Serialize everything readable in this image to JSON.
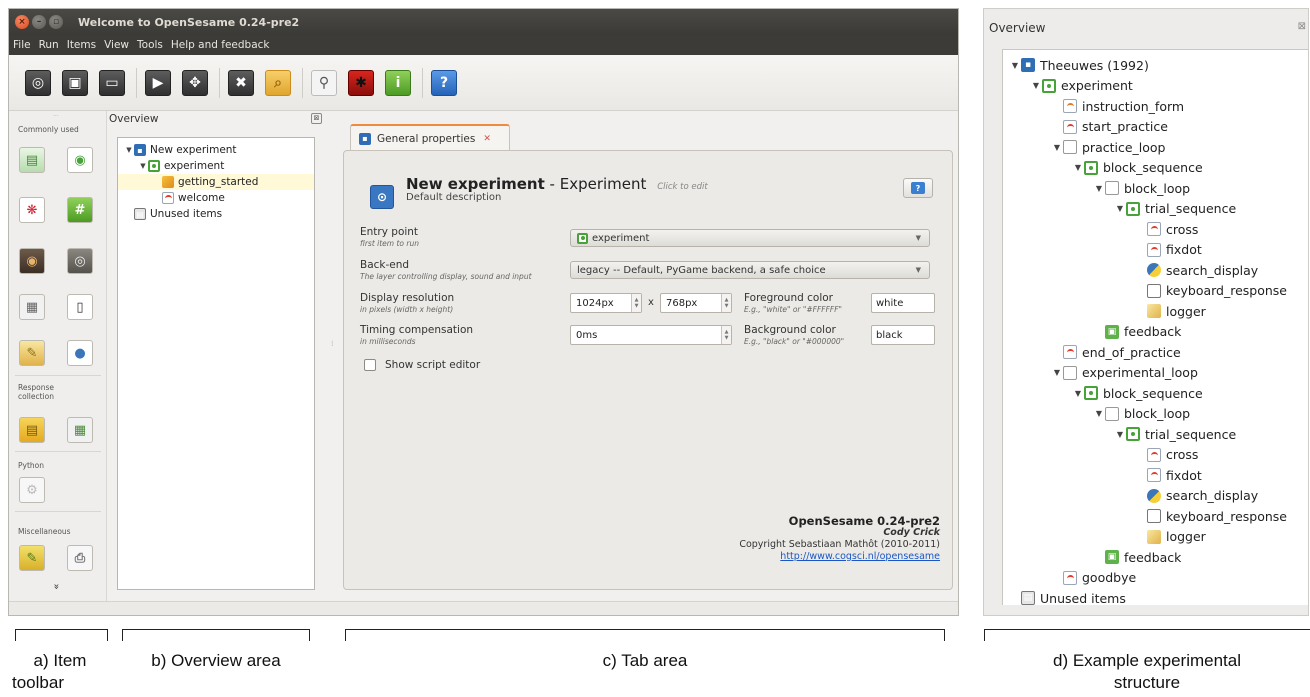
{
  "window": {
    "title": "Welcome to OpenSesame 0.24-pre2",
    "menu": [
      "File",
      "Run",
      "Items",
      "View",
      "Tools",
      "Help and feedback"
    ]
  },
  "toolbar_icons": [
    "new-icon",
    "open-icon",
    "save-icon",
    "run-icon",
    "run-window-icon",
    "kill-icon",
    "folder-icon",
    "search-icon",
    "bug-icon",
    "info-icon",
    "help-icon"
  ],
  "item_toolbar": {
    "categories": {
      "common": "Commonly used",
      "response": "Response collection",
      "python": "Python",
      "misc": "Miscellaneous"
    },
    "more_glyph": "»"
  },
  "overview": {
    "title": "Overview",
    "items": [
      {
        "label": "New experiment",
        "icon": "experiment-icon",
        "indent": 0,
        "arrow": "▼"
      },
      {
        "label": "experiment",
        "icon": "sequence-icon",
        "indent": 1,
        "arrow": "▼"
      },
      {
        "label": "getting_started",
        "icon": "inline-script-icon",
        "indent": 2,
        "arrow": ""
      },
      {
        "label": "welcome",
        "icon": "sketchpad-icon",
        "indent": 2,
        "arrow": ""
      },
      {
        "label": "Unused items",
        "icon": "trash-icon",
        "indent": 0,
        "arrow": ""
      }
    ]
  },
  "tab": {
    "label": "General properties",
    "experiment_name": "New experiment",
    "experiment_type": "- Experiment",
    "click_to_edit": "Click to edit",
    "description": "Default description",
    "entry_point_label": "Entry point",
    "entry_point_sub": "first item to run",
    "entry_point_value": "experiment",
    "backend_label": "Back-end",
    "backend_sub": "The layer controlling display, sound and input",
    "backend_value": "legacy -- Default, PyGame backend, a safe choice",
    "resolution_label": "Display resolution",
    "resolution_sub": "in pixels (width x height)",
    "width_value": "1024px",
    "x_sep": "x",
    "height_value": "768px",
    "fg_label": "Foreground color",
    "fg_sub": "E.g., \"white\" or \"#FFFFFF\"",
    "fg_value": "white",
    "timing_label": "Timing compensation",
    "timing_sub": "in milliseconds",
    "timing_value": "0ms",
    "bg_label": "Background color",
    "bg_sub": "E.g., \"black\" or \"#000000\"",
    "bg_value": "black",
    "script_editor_label": "Show script editor",
    "credits_version": "OpenSesame 0.24-pre2",
    "credits_codename": "Cody Crick",
    "credits_copyright": "Copyright Sebastiaan Mathôt (2010-2011)",
    "credits_url": "http://www.cogsci.nl/opensesame"
  },
  "example_structure": {
    "title": "Overview",
    "items": [
      {
        "label": "Theeuwes (1992)",
        "icon": "experiment-icon",
        "indent": 0,
        "arrow": "▼"
      },
      {
        "label": "experiment",
        "icon": "sequence-icon",
        "indent": 1,
        "arrow": "▼"
      },
      {
        "label": "instruction_form",
        "icon": "form-icon",
        "indent": 2,
        "arrow": ""
      },
      {
        "label": "start_practice",
        "icon": "sketchpad-icon",
        "indent": 2,
        "arrow": ""
      },
      {
        "label": "practice_loop",
        "icon": "loop-icon",
        "indent": 2,
        "arrow": "▼"
      },
      {
        "label": "block_sequence",
        "icon": "sequence-icon",
        "indent": 3,
        "arrow": "▼"
      },
      {
        "label": "block_loop",
        "icon": "loop-icon",
        "indent": 4,
        "arrow": "▼"
      },
      {
        "label": "trial_sequence",
        "icon": "sequence-icon",
        "indent": 5,
        "arrow": "▼"
      },
      {
        "label": "cross",
        "icon": "sketchpad-icon",
        "indent": 6,
        "arrow": ""
      },
      {
        "label": "fixdot",
        "icon": "sketchpad-icon",
        "indent": 6,
        "arrow": ""
      },
      {
        "label": "search_display",
        "icon": "python-icon",
        "indent": 6,
        "arrow": ""
      },
      {
        "label": "keyboard_response",
        "icon": "keyboard-icon",
        "indent": 6,
        "arrow": ""
      },
      {
        "label": "logger",
        "icon": "logger-icon",
        "indent": 6,
        "arrow": ""
      },
      {
        "label": "feedback",
        "icon": "feedback-icon",
        "indent": 4,
        "arrow": ""
      },
      {
        "label": "end_of_practice",
        "icon": "sketchpad-icon",
        "indent": 2,
        "arrow": ""
      },
      {
        "label": "experimental_loop",
        "icon": "loop-icon",
        "indent": 2,
        "arrow": "▼"
      },
      {
        "label": "block_sequence",
        "icon": "sequence-icon",
        "indent": 3,
        "arrow": "▼"
      },
      {
        "label": "block_loop",
        "icon": "loop-icon",
        "indent": 4,
        "arrow": "▼"
      },
      {
        "label": "trial_sequence",
        "icon": "sequence-icon",
        "indent": 5,
        "arrow": "▼"
      },
      {
        "label": "cross",
        "icon": "sketchpad-icon",
        "indent": 6,
        "arrow": ""
      },
      {
        "label": "fixdot",
        "icon": "sketchpad-icon",
        "indent": 6,
        "arrow": ""
      },
      {
        "label": "search_display",
        "icon": "python-icon",
        "indent": 6,
        "arrow": ""
      },
      {
        "label": "keyboard_response",
        "icon": "keyboard-icon",
        "indent": 6,
        "arrow": ""
      },
      {
        "label": "logger",
        "icon": "logger-icon",
        "indent": 6,
        "arrow": ""
      },
      {
        "label": "feedback",
        "icon": "feedback-icon",
        "indent": 4,
        "arrow": ""
      },
      {
        "label": "goodbye",
        "icon": "sketchpad-icon",
        "indent": 2,
        "arrow": ""
      },
      {
        "label": "Unused items",
        "icon": "trash-icon",
        "indent": 0,
        "arrow": ""
      }
    ]
  },
  "annotations": {
    "a1": "a) Item",
    "a2": "toolbar",
    "b": "b) Overview area",
    "c": "c) Tab area",
    "d1": "d) Example experimental",
    "d2": "structure"
  },
  "colors": {
    "tab_accent": "#f08a3c",
    "link": "#1b57c4",
    "titlebar": "#3c3b37",
    "experiment_icon": "#2f6db5",
    "sequence_icon": "#48a23a"
  }
}
